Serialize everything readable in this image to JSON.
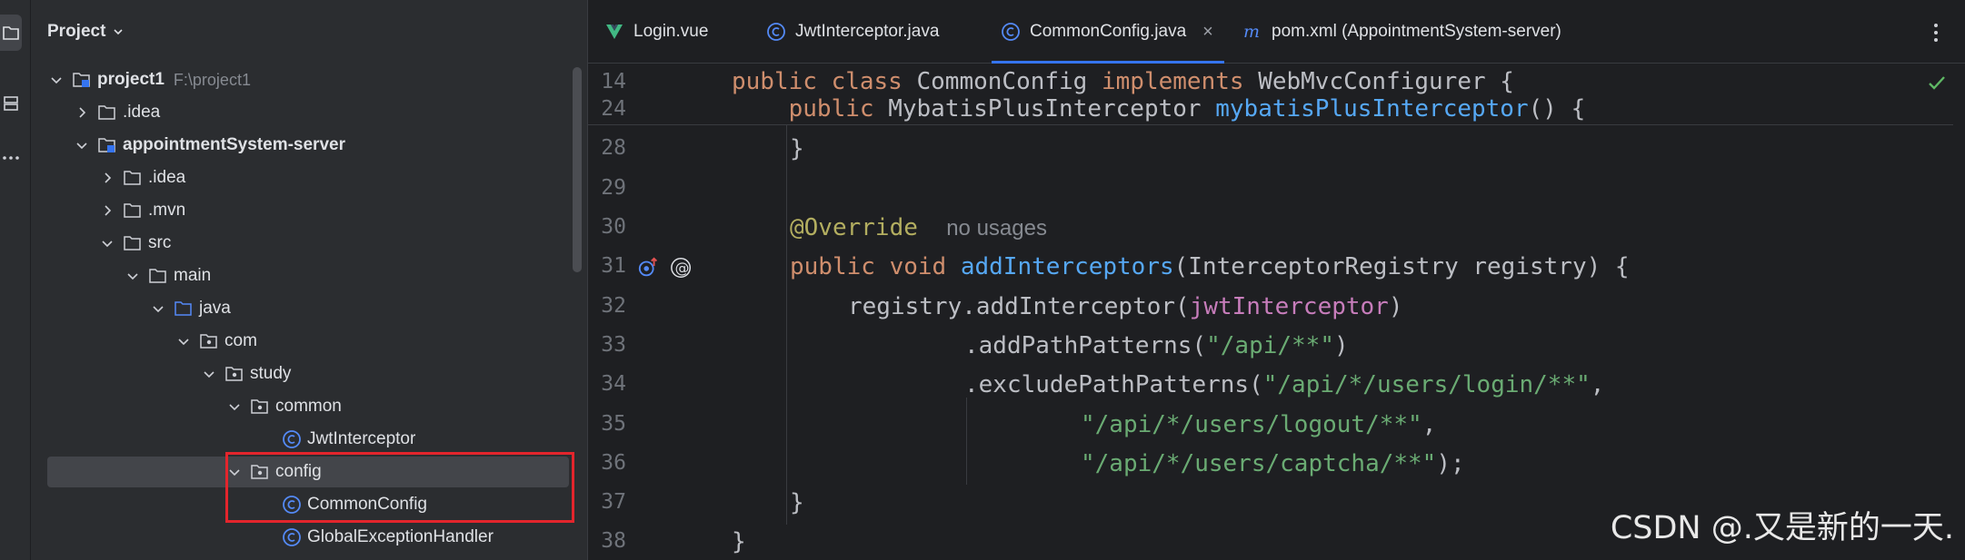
{
  "project_panel": {
    "title": "Project",
    "tree": [
      {
        "label": "project1",
        "path": "F:\\project1",
        "bold": true,
        "depth": 0,
        "expanded": true,
        "icon": "module-folder-icon"
      },
      {
        "label": ".idea",
        "depth": 1,
        "expanded": false,
        "icon": "folder-icon"
      },
      {
        "label": "appointmentSystem-server",
        "bold": true,
        "depth": 1,
        "expanded": true,
        "icon": "module-folder-icon"
      },
      {
        "label": ".idea",
        "depth": 2,
        "expanded": false,
        "icon": "folder-icon"
      },
      {
        "label": ".mvn",
        "depth": 2,
        "expanded": false,
        "icon": "folder-icon"
      },
      {
        "label": "src",
        "depth": 2,
        "expanded": true,
        "icon": "folder-icon"
      },
      {
        "label": "main",
        "depth": 3,
        "expanded": true,
        "icon": "folder-icon"
      },
      {
        "label": "java",
        "depth": 4,
        "expanded": true,
        "icon": "source-folder-icon"
      },
      {
        "label": "com",
        "depth": 5,
        "expanded": true,
        "icon": "package-icon"
      },
      {
        "label": "study",
        "depth": 6,
        "expanded": true,
        "icon": "package-icon"
      },
      {
        "label": "common",
        "depth": 7,
        "expanded": true,
        "icon": "package-icon"
      },
      {
        "label": "JwtInterceptor",
        "depth": 8,
        "icon": "class-icon"
      },
      {
        "label": "config",
        "depth": 7,
        "expanded": true,
        "icon": "package-icon",
        "selected": true
      },
      {
        "label": "CommonConfig",
        "depth": 8,
        "icon": "class-icon"
      },
      {
        "label": "GlobalExceptionHandler",
        "depth": 8,
        "icon": "class-icon"
      }
    ]
  },
  "editor": {
    "tabs": [
      {
        "label": "Login.vue",
        "icon": "vue-icon",
        "active": false
      },
      {
        "label": "JwtInterceptor.java",
        "icon": "class-icon",
        "active": false
      },
      {
        "label": "CommonConfig.java",
        "icon": "class-icon",
        "active": true,
        "close": "×"
      },
      {
        "label": "pom.xml (AppointmentSystem-server)",
        "icon": "maven-icon",
        "active": false
      }
    ],
    "sticky_lines": [
      {
        "num": "14",
        "text": "public class CommonConfig implements WebMvcConfigurer {"
      },
      {
        "num": "24",
        "text": "    public MybatisPlusInterceptor mybatisPlusInterceptor() {"
      }
    ],
    "line_numbers": [
      "28",
      "29",
      "30",
      "31",
      "32",
      "33",
      "34",
      "35",
      "36",
      "37",
      "38"
    ],
    "code": {
      "l28": "}",
      "l30_annotation": "@Override",
      "l30_hint": "no usages",
      "l31_kw": "public void ",
      "l31_fn": "addInterceptors",
      "l31_rest": "(InterceptorRegistry registry) {",
      "l32_pre": "registry.addInterceptor(",
      "l32_field": "jwtInterceptor",
      "l32_post": ")",
      "l33_pre": ".addPathPatterns(",
      "l33_str": "\"/api/**\"",
      "l33_post": ")",
      "l34_pre": ".excludePathPatterns(",
      "l34_str": "\"/api/*/users/login/**\"",
      "l34_post": ",",
      "l35_str": "\"/api/*/users/logout/**\"",
      "l35_post": ",",
      "l36_str": "\"/api/*/users/captcha/**\"",
      "l36_post": ");",
      "l37": "}",
      "l38": "}"
    }
  },
  "watermark": "CSDN @.又是新的一天.",
  "colors": {
    "keyword": "#cf8e6d",
    "annotation": "#b3ae60",
    "method": "#56a8f5",
    "string": "#6aab73",
    "field": "#c77dbb",
    "selection": "#43454a",
    "highlight_box": "#e3252c",
    "accent": "#3574f0"
  }
}
